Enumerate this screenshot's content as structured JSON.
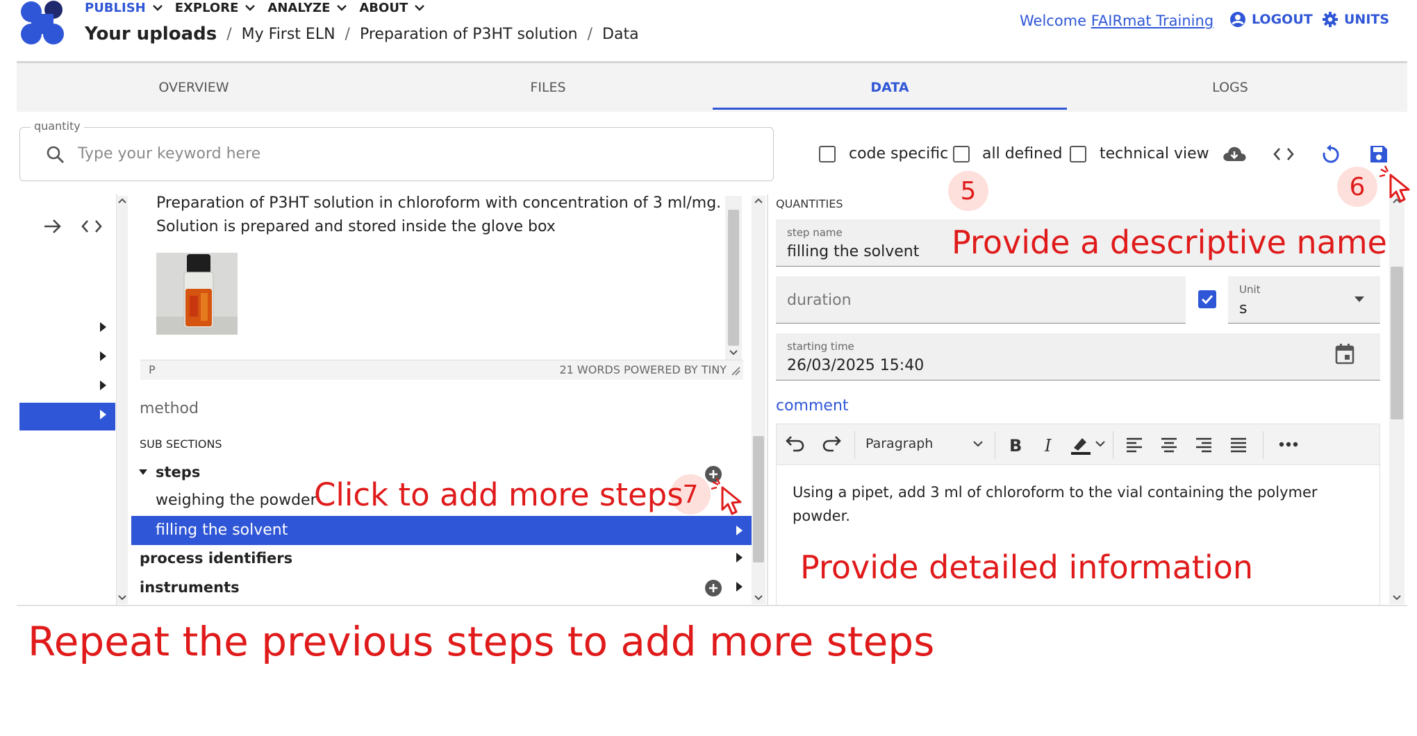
{
  "colors": {
    "brand": "#2f56d6",
    "annotation": "#e01a1a",
    "badge_bg": "#fde0dc"
  },
  "nav": {
    "items": [
      {
        "label": "PUBLISH",
        "icon": "chevron-down-icon"
      },
      {
        "label": "EXPLORE",
        "icon": "chevron-down-icon"
      },
      {
        "label": "ANALYZE",
        "icon": "chevron-down-icon"
      },
      {
        "label": "ABOUT",
        "icon": "chevron-down-icon"
      }
    ]
  },
  "breadcrumb": {
    "items": [
      "Your uploads",
      "My First ELN",
      "Preparation of P3HT solution",
      "Data"
    ],
    "separator": "/"
  },
  "header": {
    "welcome_prefix": "Welcome",
    "user_name": "FAIRmat Training",
    "logout_label": "LOGOUT",
    "units_label": "UNITS"
  },
  "tabs": [
    "OVERVIEW",
    "FILES",
    "DATA",
    "LOGS"
  ],
  "active_tab": "DATA",
  "search": {
    "legend": "quantity",
    "placeholder": "Type your keyword here"
  },
  "toolbar": {
    "checkboxes": [
      {
        "label": "code specific",
        "checked": false
      },
      {
        "label": "all defined",
        "checked": false
      },
      {
        "label": "technical view",
        "checked": false
      }
    ],
    "icons": [
      "download-cloud-icon",
      "code-icon",
      "reload-icon",
      "save-icon"
    ]
  },
  "editor": {
    "description": "Preparation of P3HT solution in chloroform with concentration of 3 ml/mg. Solution is prepared and stored inside the glove box",
    "status_left": "P",
    "status_right": "21 WORDS  POWERED BY TINY"
  },
  "tree": {
    "method_label": "method",
    "subsections_label": "SUB SECTIONS",
    "steps_label": "steps",
    "step_items": [
      "weighing the powder",
      "filling the solvent"
    ],
    "selected_step": "filling the solvent",
    "other_sections": [
      "process identifiers",
      "instruments"
    ]
  },
  "quantities": {
    "heading": "QUANTITIES",
    "step_name_label": "step name",
    "step_name_value": "filling the solvent",
    "duration_placeholder": "duration",
    "unit_label": "Unit",
    "unit_value": "s",
    "starting_time_label": "starting time",
    "starting_time_value": "26/03/2025 15:40",
    "comment_label": "comment",
    "paragraph_select": "Paragraph",
    "comment_text": "Using a pipet, add 3 ml of chloroform to the vial containing the polymer powder."
  },
  "annotations": {
    "badge_5": "5",
    "badge_6": "6",
    "badge_7": "7",
    "descriptive_name": "Provide a descriptive name",
    "add_steps": "Click to add more steps",
    "detailed_info": "Provide detailed information",
    "repeat": "Repeat the previous steps to add more steps"
  }
}
